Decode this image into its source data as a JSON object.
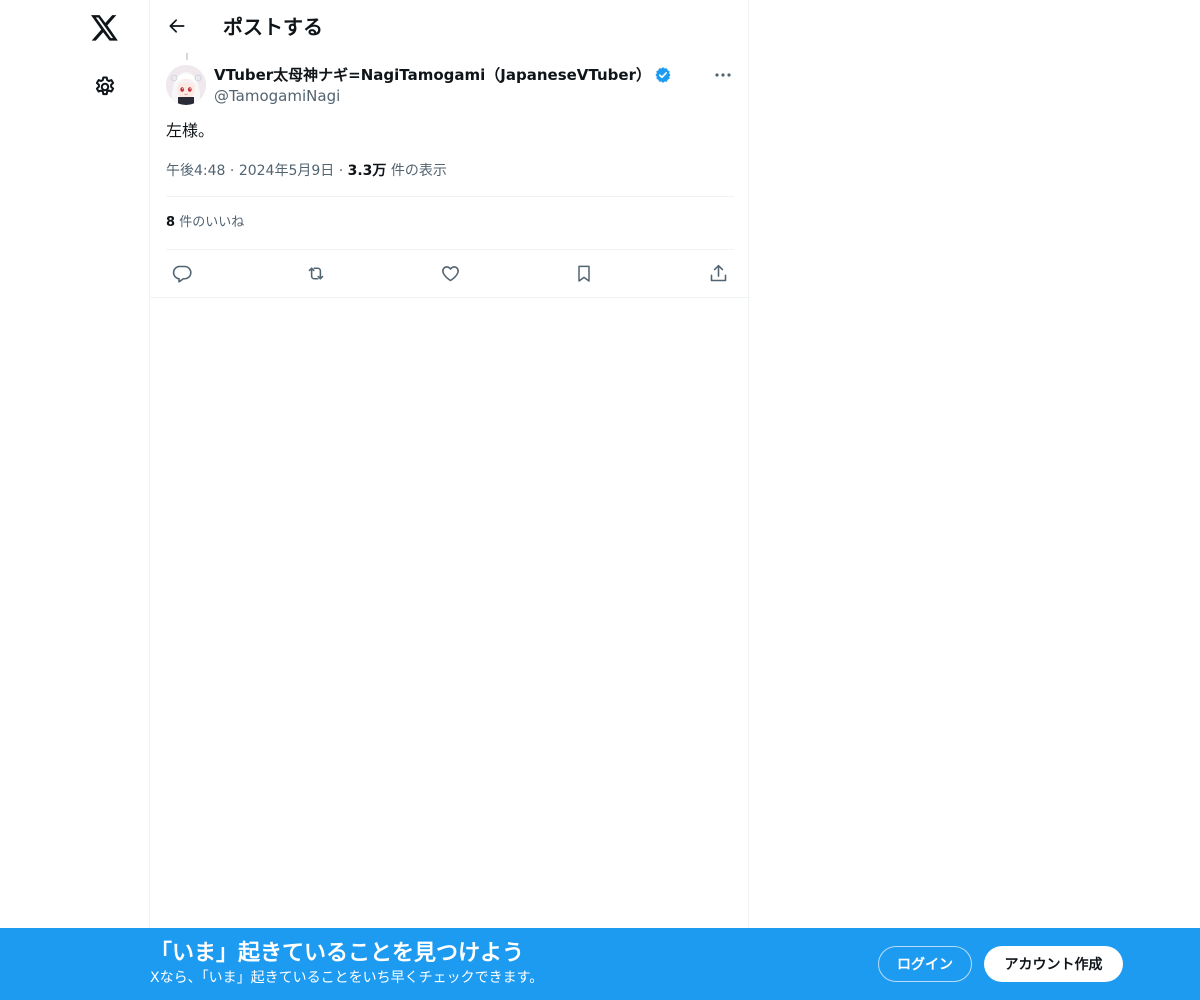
{
  "nav": {
    "logo_icon": "x-logo-icon",
    "settings_icon": "gear-icon"
  },
  "header": {
    "title": "ポストする",
    "back_icon": "arrow-left-icon"
  },
  "post": {
    "author_name": "VTuber太母神ナギ=NagiTamogami（JapaneseVTuber）",
    "handle": "@TamogamiNagi",
    "text": "左様。",
    "time": "午後4:48",
    "date": "2024年5月9日",
    "sep": "·",
    "views_count": "3.3万",
    "views_label": "件の表示",
    "likes_count": "8",
    "likes_label": "件のいいね"
  },
  "actions": [
    "reply-icon",
    "repost-icon",
    "like-icon",
    "bookmark-icon",
    "share-icon"
  ],
  "banner": {
    "title": "「いま」起きていることを見つけよう",
    "subtitle": "Xなら、「いま」起きていることをいち早くチェックできます。",
    "login": "ログイン",
    "signup": "アカウント作成"
  },
  "colors": {
    "accent": "#1d9bf0",
    "text": "#0f1419",
    "secondary": "#536471",
    "border": "#eff3f4"
  }
}
